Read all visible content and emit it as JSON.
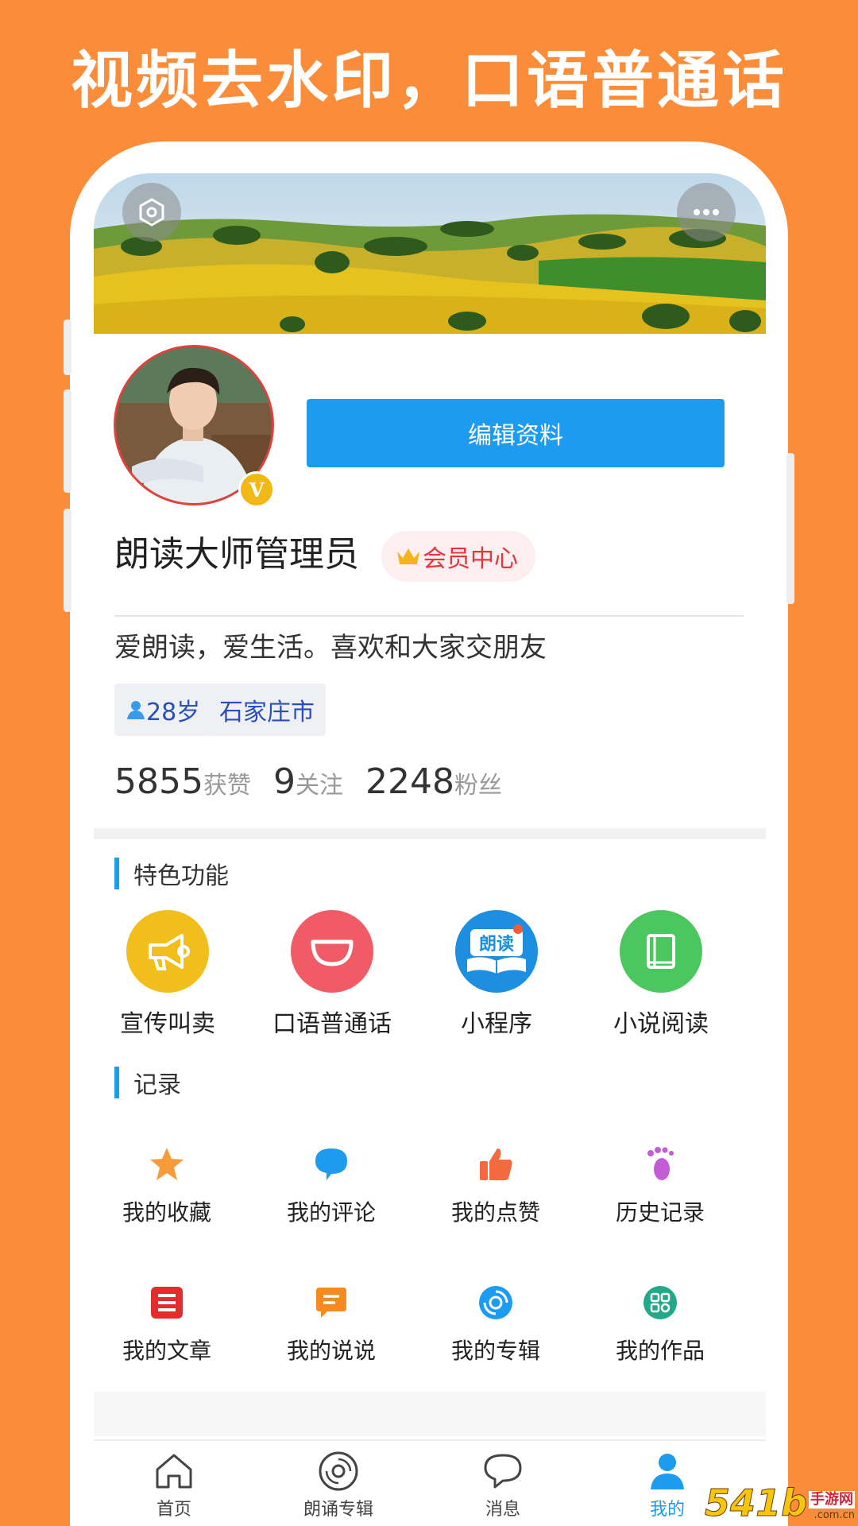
{
  "headline": "视频去水印，口语普通话",
  "profile": {
    "edit_button": "编辑资料",
    "username": "朗读大师管理员",
    "vip_label": "会员中心",
    "verified_mark": "V",
    "bio": "爱朗读，爱生活。喜欢和大家交朋友",
    "tags": {
      "age": "28岁",
      "city": "石家庄市"
    },
    "stats": [
      {
        "value": "5855",
        "label": "获赞"
      },
      {
        "value": "9",
        "label": "关注"
      },
      {
        "value": "2248",
        "label": "粉丝"
      }
    ]
  },
  "features": {
    "title": "特色功能",
    "items": [
      {
        "label": "宣传叫卖",
        "icon": "megaphone-icon",
        "color": "#F2BE1B"
      },
      {
        "label": "口语普通话",
        "icon": "mouth-icon",
        "color": "#F05B65"
      },
      {
        "label": "小程序",
        "icon": "reading-book-icon",
        "color": "#1C8FE0",
        "icon_text": "朗读"
      },
      {
        "label": "小说阅读",
        "icon": "book-icon",
        "color": "#4CC65E"
      }
    ]
  },
  "records": {
    "title": "记录",
    "items": [
      {
        "label": "我的收藏",
        "icon": "star-icon",
        "color": "#F89B3A"
      },
      {
        "label": "我的评论",
        "icon": "comment-icon",
        "color": "#1C9BF0"
      },
      {
        "label": "我的点赞",
        "icon": "thumbs-up-icon",
        "color": "#F26A3D"
      },
      {
        "label": "历史记录",
        "icon": "footprint-icon",
        "color": "#C45CD6"
      },
      {
        "label": "我的文章",
        "icon": "article-icon",
        "color": "#E52B2B"
      },
      {
        "label": "我的说说",
        "icon": "chat-icon",
        "color": "#F58A1F"
      },
      {
        "label": "我的专辑",
        "icon": "disc-icon",
        "color": "#1C9BF0"
      },
      {
        "label": "我的作品",
        "icon": "apps-icon",
        "color": "#22A98A"
      }
    ]
  },
  "tabbar": [
    {
      "label": "首页",
      "icon": "home-icon"
    },
    {
      "label": "朗诵专辑",
      "icon": "vinyl-icon"
    },
    {
      "label": "消息",
      "icon": "message-icon"
    },
    {
      "label": "我的",
      "icon": "person-icon",
      "active": true
    }
  ],
  "watermark": {
    "number": "54",
    "glyph": "1b",
    "text": "手游网",
    "domain": ".com.cn"
  },
  "colors": {
    "background": "#FA8C3A",
    "accent": "#1C9BF0",
    "vip": "#E8343E"
  }
}
